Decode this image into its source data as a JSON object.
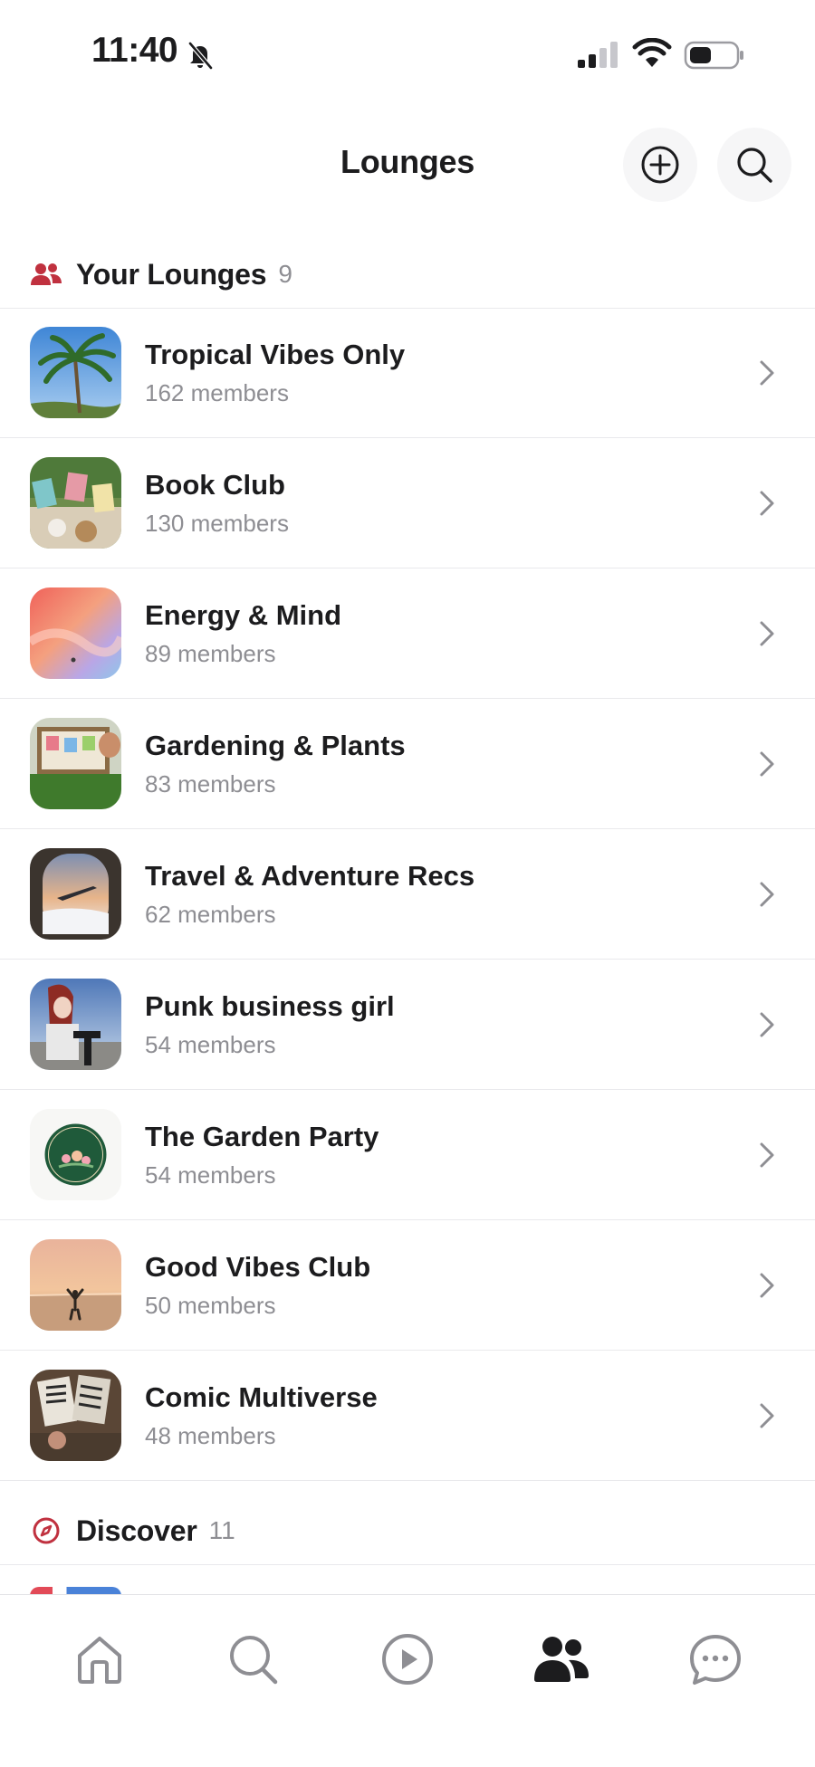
{
  "status_bar": {
    "time": "11:40",
    "icons": [
      "bell-slash-icon",
      "cellular-signal-icon",
      "wifi-icon",
      "battery-icon"
    ]
  },
  "header": {
    "title": "Lounges",
    "add_icon": "plus-circle-icon",
    "search_icon": "search-icon"
  },
  "your_lounges": {
    "title": "Your Lounges",
    "count": "9",
    "icon": "people-icon",
    "accent": "#c0313f",
    "items": [
      {
        "name": "Tropical Vibes Only",
        "members": "162 members",
        "thumb": "palm-tree-photo"
      },
      {
        "name": "Book Club",
        "members": "130 members",
        "thumb": "books-photo"
      },
      {
        "name": "Energy & Mind",
        "members": "89 members",
        "thumb": "gradient-art"
      },
      {
        "name": "Gardening & Plants",
        "members": "83 members",
        "thumb": "garden-photo"
      },
      {
        "name": "Travel & Adventure Recs",
        "members": "62 members",
        "thumb": "airplane-window-photo"
      },
      {
        "name": "Punk business girl",
        "members": "54 members",
        "thumb": "avatar-art"
      },
      {
        "name": "The Garden Party",
        "members": "54 members",
        "thumb": "garden-party-logo"
      },
      {
        "name": "Good Vibes Club",
        "members": "50 members",
        "thumb": "sunset-beach-photo"
      },
      {
        "name": "Comic Multiverse",
        "members": "48 members",
        "thumb": "comics-photo"
      }
    ]
  },
  "garden_party_logo_text": "The Garden Party",
  "discover": {
    "title": "Discover",
    "count": "11",
    "icon": "compass-icon"
  },
  "tab_bar": {
    "tabs": [
      {
        "name": "home",
        "icon": "home-icon",
        "active": false
      },
      {
        "name": "search",
        "icon": "search-icon",
        "active": false
      },
      {
        "name": "video",
        "icon": "play-circle-icon",
        "active": false
      },
      {
        "name": "lounges",
        "icon": "people-icon",
        "active": true
      },
      {
        "name": "messages",
        "icon": "chat-bubble-icon",
        "active": false
      }
    ],
    "active_color": "#1c1c1e",
    "inactive_color": "#8e8e93"
  }
}
